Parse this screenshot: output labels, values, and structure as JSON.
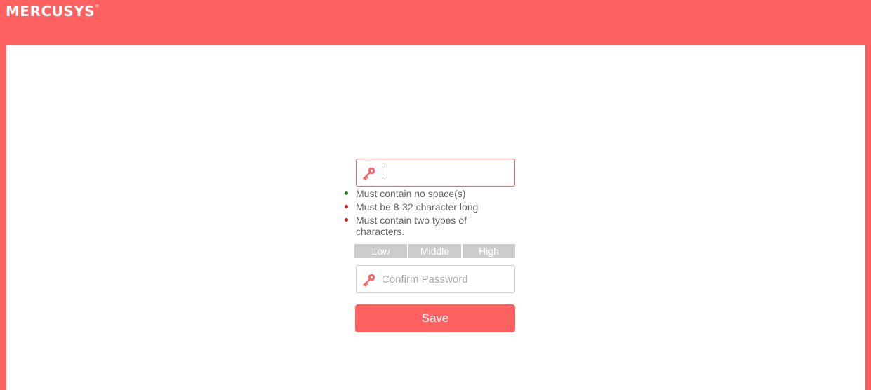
{
  "brand": {
    "name": "MERCUSYS",
    "mark": "®"
  },
  "colors": {
    "accent": "#ff6161",
    "rule_met": "#1a8a1a",
    "rule_unmet": "#e0201b",
    "strength_inactive": "#cccccc"
  },
  "password": {
    "icon": "key-icon",
    "value": "",
    "focused": true
  },
  "rules": [
    {
      "text": "Must contain no space(s)",
      "met": true
    },
    {
      "text": "Must be 8-32 character long",
      "met": false
    },
    {
      "text": "Must contain two types of characters.",
      "met": false
    }
  ],
  "strength": {
    "levels": [
      "Low",
      "Middle",
      "High"
    ]
  },
  "confirm": {
    "icon": "key-icon",
    "placeholder": "Confirm Password",
    "value": ""
  },
  "save_label": "Save"
}
